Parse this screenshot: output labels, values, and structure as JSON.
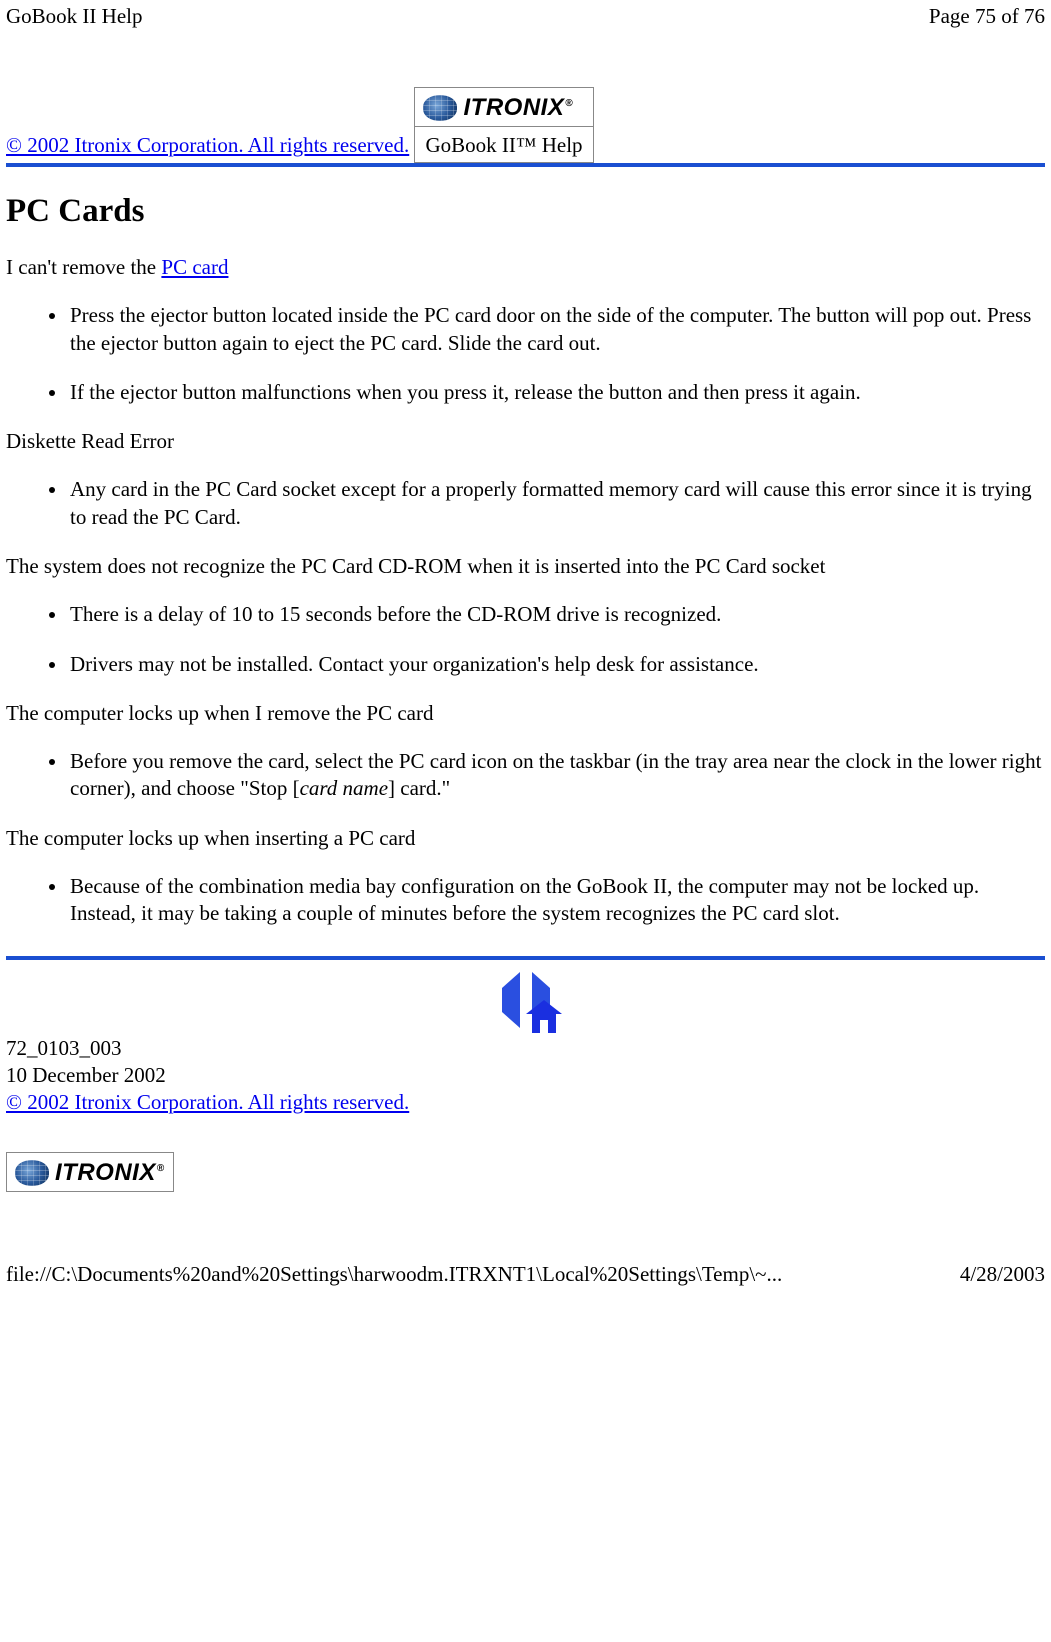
{
  "header": {
    "title": "GoBook II Help",
    "page_indicator": "Page 75 of 76"
  },
  "top_copyright": "© 2002 Itronix Corporation.  All rights reserved.",
  "logo": {
    "brand": "ITRONIX",
    "reg": "®"
  },
  "help_label": "GoBook II™ Help",
  "section": {
    "title": "PC Cards",
    "q1_prefix": "I can't remove the ",
    "q1_link": "PC card",
    "q1_bullets": [
      "Press the ejector button located inside the PC card door on the side of the computer. The button will pop out. Press the ejector button again to eject the PC card.  Slide the card out.",
      "If the ejector button malfunctions when you press it, release the button and then press it again."
    ],
    "q2": "Diskette Read Error",
    "q2_bullets": [
      "Any card in the PC Card socket except for a properly formatted memory card will cause this error since it is trying to read the PC Card."
    ],
    "q3": "The system does not recognize the PC Card CD-ROM when it is inserted into the PC Card socket",
    "q3_bullets": [
      "There is a delay of 10 to 15 seconds before the CD-ROM drive is recognized.",
      "Drivers may not be installed. Contact your organization's help desk for assistance."
    ],
    "q4": "The computer locks up when I remove the PC card",
    "q4_b1_a": "Before you remove the card, select the PC card icon on the taskbar (in the tray area near the clock in the lower right corner), and choose \"Stop [",
    "q4_b1_i": "card name",
    "q4_b1_b": "] card.\"",
    "q5": "The computer locks up when inserting a PC card",
    "q5_bullets": [
      "Because of the combination media bay configuration on the GoBook II, the computer may not be locked up.  Instead, it may be taking a couple of minutes before the system recognizes the PC card slot."
    ]
  },
  "meta": {
    "doc_number": "72_0103_003",
    "doc_date": "10 December 2002",
    "copyright": "© 2002 Itronix Corporation.  All rights reserved."
  },
  "footer": {
    "path": "file://C:\\Documents%20and%20Settings\\harwoodm.ITRXNT1\\Local%20Settings\\Temp\\~...",
    "date": "4/28/2003"
  }
}
